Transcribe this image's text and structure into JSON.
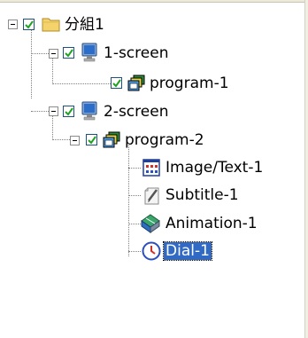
{
  "tree": {
    "group": {
      "label": "分組1",
      "checked": true
    },
    "screens": [
      {
        "label": "1-screen",
        "checked": true,
        "programs": [
          {
            "label": "program-1",
            "checked": true
          }
        ]
      },
      {
        "label": "2-screen",
        "checked": true,
        "programs": [
          {
            "label": "program-2",
            "checked": true,
            "items": [
              {
                "label": "Image/Text-1",
                "icon": "image-text-icon"
              },
              {
                "label": "Subtitle-1",
                "icon": "subtitle-icon"
              },
              {
                "label": "Animation-1",
                "icon": "animation-icon"
              },
              {
                "label": "Dial-1",
                "icon": "clock-icon",
                "selected": true
              }
            ]
          }
        ]
      }
    ]
  },
  "colors": {
    "selection_bg": "#316ac5",
    "selection_text": "#ffffff",
    "check_border": "#1c5180",
    "folder": "#f5d36b"
  }
}
